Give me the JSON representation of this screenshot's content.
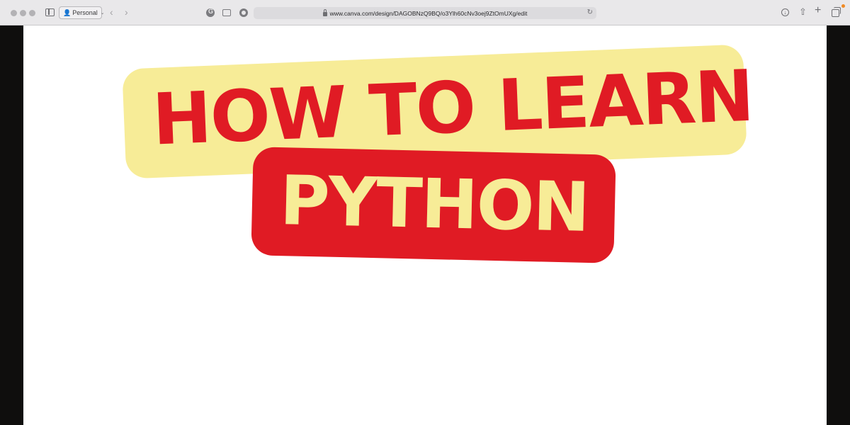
{
  "browser": {
    "profile_label": "Personal",
    "url": "www.canva.com/design/DAGOBNzQ9BQ/o3Ylh60cNv3oej9ZtOmUXg/edit",
    "icons": [
      "sidebar-icon",
      "person-icon",
      "back-icon",
      "forward-icon",
      "grammarly-icon",
      "screen-icon",
      "chat-icon",
      "lock-icon",
      "reload-icon",
      "download-icon",
      "share-icon",
      "new-tab-icon",
      "tabs-icon"
    ]
  },
  "design": {
    "line1": "HOW TO LEARN",
    "line2": "PYTHON"
  },
  "colors": {
    "yellow": "#f7ec97",
    "red": "#e01b24",
    "accent_dot": "#f08a24"
  }
}
